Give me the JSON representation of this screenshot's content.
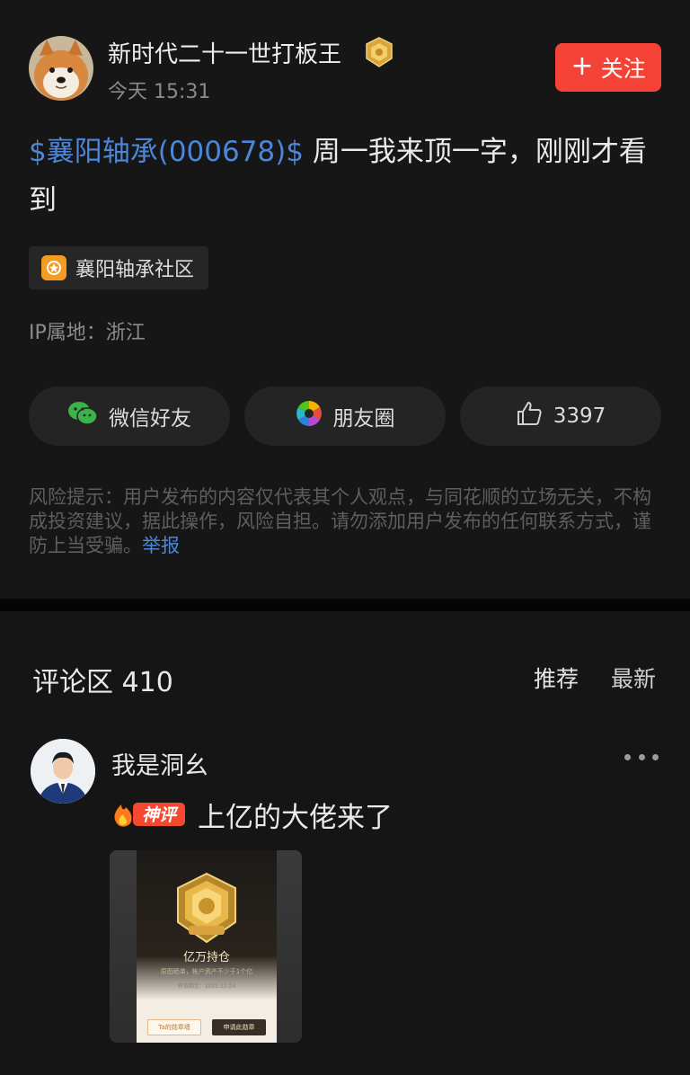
{
  "post": {
    "author": {
      "name": "新时代二十一世打板王",
      "time": "今天 15:31"
    },
    "follow_label": "关注",
    "stock_tag": "$襄阳轴承(000678)$",
    "text": " 周一我来顶一字，刚刚才看到",
    "community": "襄阳轴承社区",
    "ip_location": "IP属地：浙江",
    "share": {
      "wechat_label": "微信好友",
      "moments_label": "朋友圈",
      "like_count": "3397"
    },
    "risk_notice": "风险提示：用户发布的内容仅代表其个人观点，与同花顺的立场无关，不构成投资建议，据此操作，风险自担。请勿添加用户发布的任何联系方式，谨防上当受骗。",
    "report_label": "举报"
  },
  "comments": {
    "title": "评论区 410",
    "sort_options": [
      "推荐",
      "最新"
    ],
    "items": [
      {
        "author": "我是洞幺",
        "badge": "神评",
        "text": "上亿的大佬来了",
        "image": {
          "medal_title": "亿万持仓",
          "medal_subtitle": "原图晒单，帐户资产不少于1个亿",
          "medal_date": "有效期至：2025.12.24",
          "button_left": "Ta的勋章墙",
          "button_right": "申请此勋章"
        }
      }
    ]
  },
  "colors": {
    "accent_blue": "#4c86d8",
    "follow_red": "#f44336",
    "background": "#161616"
  }
}
